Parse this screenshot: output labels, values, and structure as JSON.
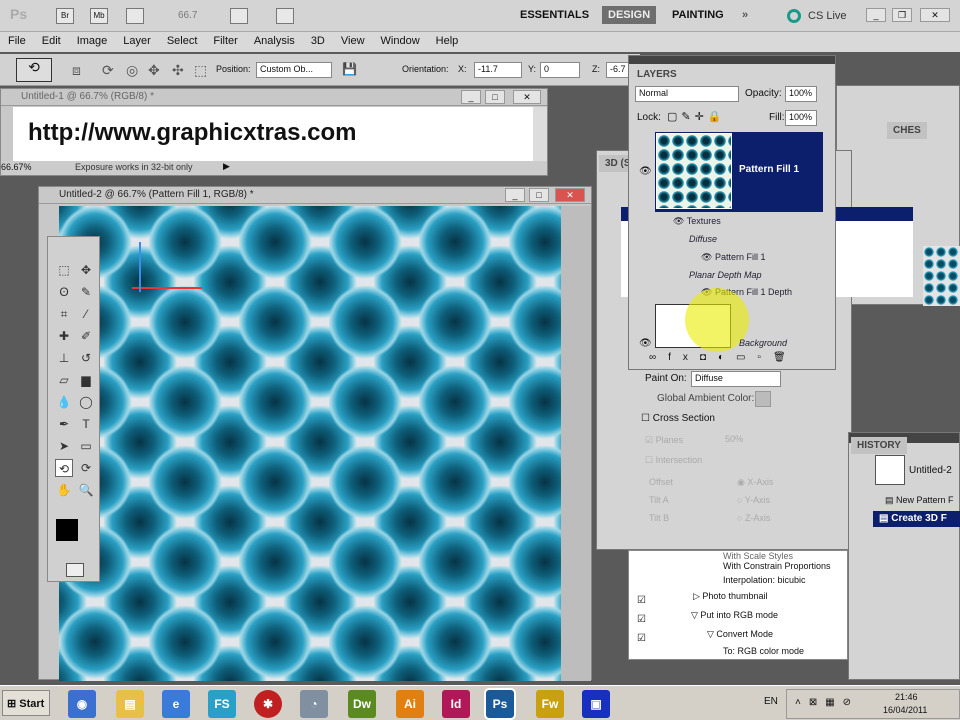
{
  "appbar": {
    "bridge": "Br",
    "minibridge": "Mb",
    "zoom": "66.7",
    "workspaces": [
      "ESSENTIALS",
      "DESIGN",
      "PAINTING"
    ],
    "more": "»",
    "cslive": "CS Live",
    "active_workspace": "DESIGN"
  },
  "menu": [
    "File",
    "Edit",
    "Image",
    "Layer",
    "Select",
    "Filter",
    "Analysis",
    "3D",
    "View",
    "Window",
    "Help"
  ],
  "options": {
    "position_label": "Position:",
    "position_value": "Custom Ob...",
    "orientation_label": "Orientation:",
    "x_label": "X:",
    "x_value": "-11.7",
    "y_label": "Y:",
    "y_value": "0",
    "z_label": "Z:",
    "z_value": "-6.7"
  },
  "doc1": {
    "title": "Untitled-1 @ 66.7% (RGB/8) *",
    "content_text": "http://www.graphicxtras.com",
    "zoom": "66.67%",
    "status": "Exposure works in 32-bit only"
  },
  "doc2": {
    "title": "Untitled-2 @ 66.7% (Pattern Fill 1, RGB/8) *"
  },
  "layers": {
    "tab": "LAYERS",
    "blend_mode": "Normal",
    "opacity_label": "Opacity:",
    "opacity": "100%",
    "lock_label": "Lock:",
    "fill_label": "Fill:",
    "fill": "100%",
    "selected_layer": "Pattern Fill 1",
    "textures": "Textures",
    "diffuse": "Diffuse",
    "diffuse_item": "Pattern Fill 1",
    "depth_map": "Planar Depth Map",
    "depth_item": "Pattern Fill 1 Depth",
    "background": "Background"
  },
  "panel3d": {
    "tab": "3D (S",
    "paint_on_label": "Paint On:",
    "paint_on": "Diffuse",
    "ambient_label": "Global Ambient Color:",
    "cross_section": "Cross Section",
    "planes": "Planes",
    "percent": "50%",
    "intersection": "Intersection",
    "offset": "Offset",
    "tilt_a": "Tilt A",
    "tilt_b": "Tilt B",
    "x_axis": "X-Axis",
    "y_axis": "Y-Axis",
    "z_axis": "Z-Axis"
  },
  "swatches_tab": "CHES",
  "history": {
    "tab": "HISTORY",
    "snapshot": "Untitled-2",
    "items": [
      "New Pattern F",
      "Create 3D F"
    ]
  },
  "actions": {
    "items": [
      "With Scale Styles",
      "With Constrain Proportions",
      "Interpolation: bicubic",
      "Photo thumbnail",
      "Put into RGB mode",
      "Convert Mode",
      "To: RGB color mode"
    ]
  },
  "taskbar": {
    "start": "Start",
    "apps": [
      "Dw",
      "Ai",
      "Id",
      "Ps",
      "Fw"
    ],
    "lang": "EN",
    "time": "21:46",
    "date": "16/04/2011"
  },
  "colors": {
    "selection": "#0c1f6d",
    "workspace": "#5a5a5a",
    "design_tab": "#6e6e6e"
  }
}
